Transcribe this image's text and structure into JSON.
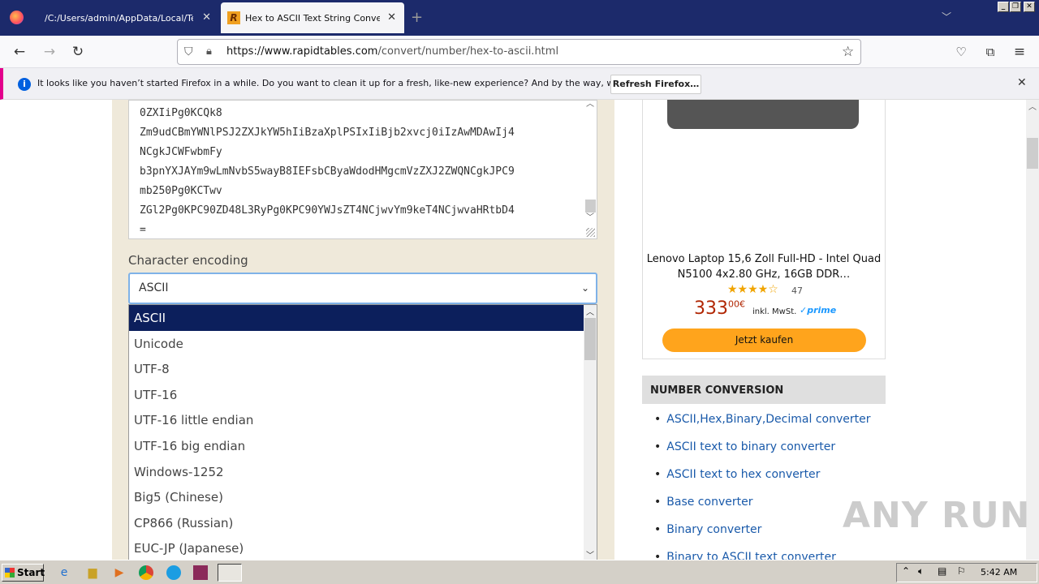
{
  "tabs": [
    {
      "label": "/C:/Users/admin/AppData/Local/Temp/",
      "active": false
    },
    {
      "label": "Hex to ASCII Text String Converte",
      "active": true
    }
  ],
  "new_tab": "+",
  "nav": {
    "url_host": "https://www.rapidtables.com",
    "url_path": "/convert/number/hex-to-ascii.html"
  },
  "notification": {
    "message": "It looks like you haven’t started Firefox in a while. Do you want to clean it up for a fresh, like-new experience? And by the way, welcome back!",
    "button": "Refresh Firefox…"
  },
  "textarea_lines": [
    "0ZXIiPg0KCQk8",
    "Zm9udCBmYWNlPSJ2ZXJkYW5hIiBzaXplPSIxIiBjb2xvcj0iIzAwMDAwIj4",
    "NCgkJCWFwbmFy",
    "b3pnYXJAYm9wLmNvbS5wayB8IEFsbCByaWdodHMgcmVzZXJ2ZWQNCgkJPC9",
    "mb250Pg0KCTwv",
    "ZGl2Pg0KPC90ZD48L3RyPg0KPC90YWJsZT4NCjwvYm9keT4NCjwvaHRtbD4",
    "="
  ],
  "encoding": {
    "label": "Character encoding",
    "selected": "ASCII",
    "options": [
      "ASCII",
      "Unicode",
      "UTF-8",
      "UTF-16",
      "UTF-16 little endian",
      "UTF-16 big endian",
      "Windows-1252",
      "Big5 (Chinese)",
      "CP866 (Russian)",
      "EUC-JP (Japanese)"
    ]
  },
  "ad": {
    "title": "Lenovo Laptop 15,6 Zoll Full-HD - Intel Quad N5100 4x2.80 GHz, 16GB DDR…",
    "stars": "★★★★☆",
    "rating_count": "47",
    "price_main": "333",
    "price_cents": "00€",
    "tax_note": "inkl. MwSt.",
    "prime": "✓prime",
    "buy_button": "Jetzt kaufen"
  },
  "sidebar": {
    "heading": "NUMBER CONVERSION",
    "links": [
      "ASCII,Hex,Binary,Decimal converter",
      "ASCII text to binary converter",
      "ASCII text to hex converter",
      "Base converter",
      "Binary converter",
      "Binary to ASCII text converter"
    ]
  },
  "watermark": "ANY RUN",
  "taskbar": {
    "start": "Start",
    "clock": "5:42 AM"
  }
}
